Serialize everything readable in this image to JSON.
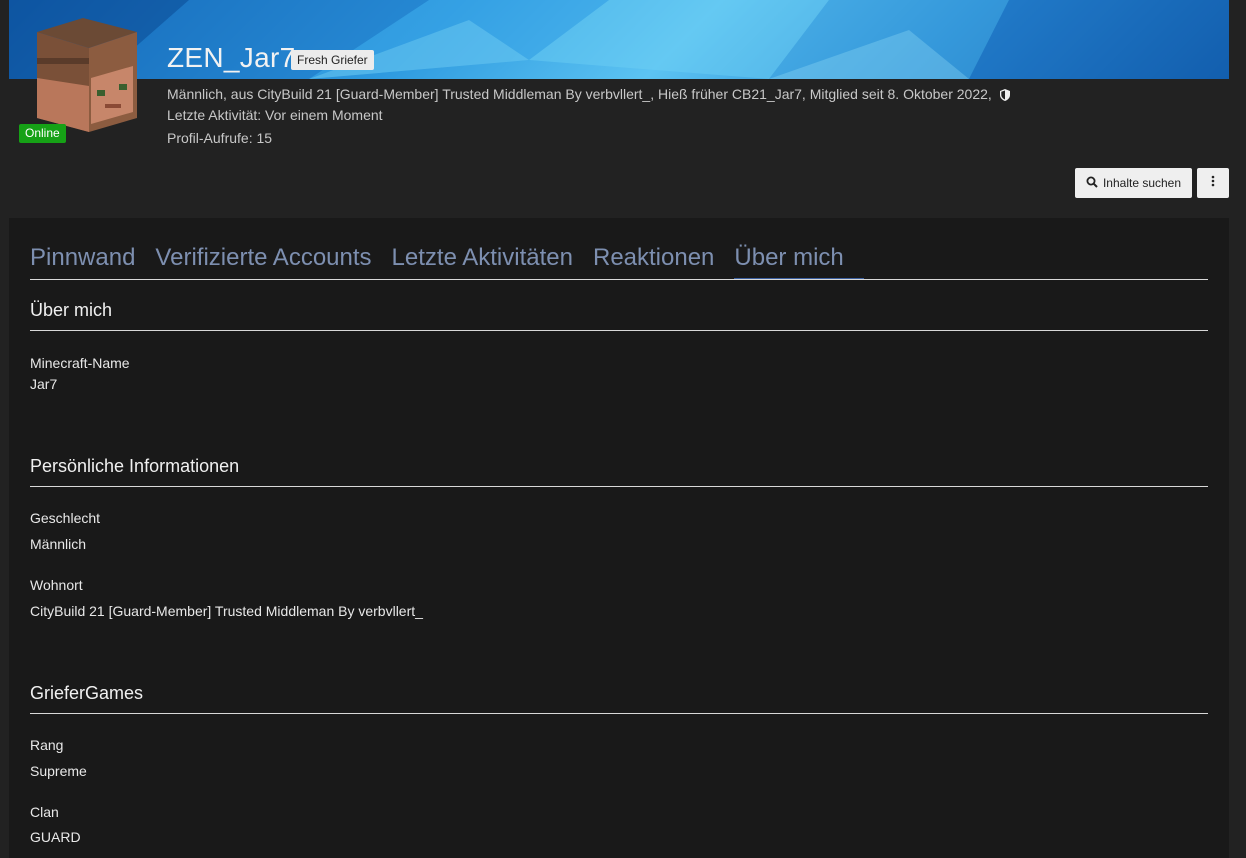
{
  "profile": {
    "username": "ZEN_Jar7",
    "rank_badge": "Fresh Griefer",
    "online_status": "Online",
    "meta_line": "Männlich, aus CityBuild 21 [Guard-Member] Trusted Middleman By verbvllert_, Hieß früher CB21_Jar7, Mitglied seit 8. Oktober 2022,",
    "last_activity": "Letzte Aktivität: Vor einem Moment",
    "profile_views": "Profil-Aufrufe: 15"
  },
  "actions": {
    "search_label": "Inhalte suchen"
  },
  "tabs": [
    {
      "label": "Pinnwand"
    },
    {
      "label": "Verifizierte Accounts"
    },
    {
      "label": "Letzte Aktivitäten"
    },
    {
      "label": "Reaktionen"
    },
    {
      "label": "Über mich"
    }
  ],
  "sections": {
    "about": {
      "title": "Über mich",
      "minecraft_label": "Minecraft-Name",
      "minecraft_value": "Jar7"
    },
    "personal": {
      "title": "Persönliche Informationen",
      "gender_label": "Geschlecht",
      "gender_value": "Männlich",
      "location_label": "Wohnort",
      "location_value": "CityBuild 21 [Guard-Member] Trusted Middleman By verbvllert_"
    },
    "griefergames": {
      "title": "GrieferGames",
      "rank_label": "Rang",
      "rank_value": "Supreme",
      "clan_label": "Clan",
      "clan_value": "GUARD"
    }
  },
  "colors": {
    "online": "#16a116",
    "tab_link": "#7d8fb0",
    "active_tab_underline": "#3b5f9e"
  },
  "icons": [
    "search-icon",
    "kebab-menu-icon",
    "shield-icon"
  ]
}
